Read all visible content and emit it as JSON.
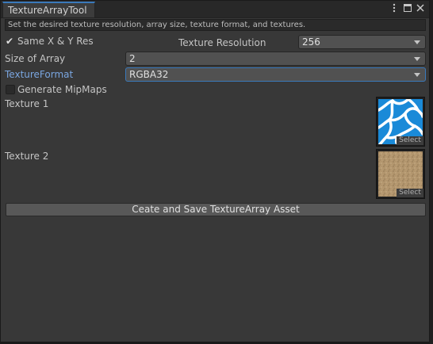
{
  "window": {
    "tab_title": "TextureArrayTool",
    "controls": [
      "kebab-menu-icon",
      "maximize-icon",
      "close-icon"
    ]
  },
  "help_text": "Set the desired texture resolution, array size, texture format, and textures.",
  "same_res": {
    "label": "Same X & Y Res",
    "checked": true
  },
  "texture_resolution": {
    "label": "Texture Resolution",
    "value": "256"
  },
  "array_size": {
    "label": "Size of Array",
    "value": "2"
  },
  "texture_format": {
    "label": "TextureFormat",
    "value": "RGBA32"
  },
  "mipmaps": {
    "label": "Generate MipMaps",
    "checked": false
  },
  "textures": [
    {
      "label": "Texture 1",
      "select_label": "Select",
      "icon": "water-caustics-thumbnail"
    },
    {
      "label": "Texture 2",
      "select_label": "Select",
      "icon": "sand-thumbnail"
    }
  ],
  "create_button": "Ceate and Save TextureArray Asset",
  "colors": {
    "accent": "#3a79bb",
    "label_highlight": "#7aa6e0",
    "panel": "#383838"
  }
}
